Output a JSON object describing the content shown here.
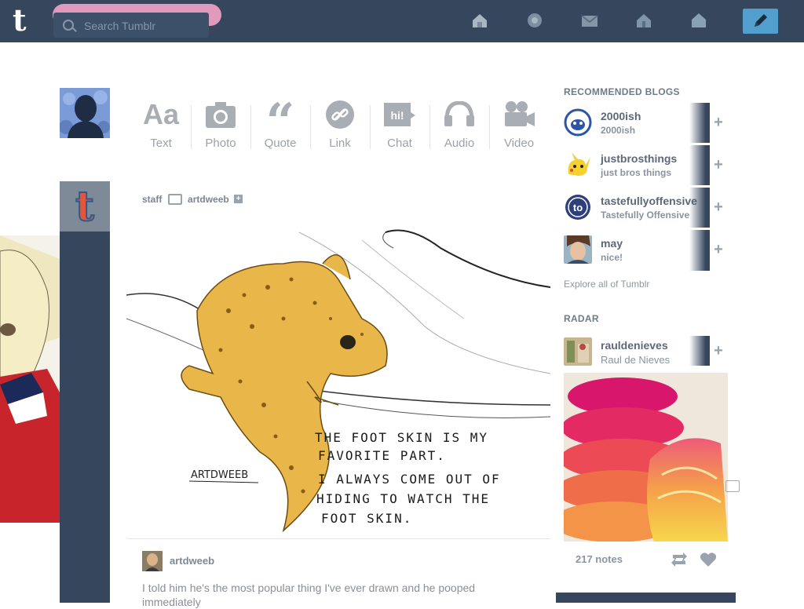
{
  "header": {
    "search_placeholder": "Search Tumblr",
    "nav_icons": [
      "home-icon",
      "explore-icon",
      "inbox-icon",
      "activity-icon",
      "account-icon"
    ],
    "compose_icon": "pencil-icon",
    "colors": {
      "bar": "#36465d",
      "compose": "#529ecc"
    }
  },
  "post_types": [
    {
      "label": "Text",
      "icon": "text-icon"
    },
    {
      "label": "Photo",
      "icon": "camera-icon"
    },
    {
      "label": "Quote",
      "icon": "quote-icon"
    },
    {
      "label": "Link",
      "icon": "link-icon"
    },
    {
      "label": "Chat",
      "icon": "chat-icon"
    },
    {
      "label": "Audio",
      "icon": "headphones-icon"
    },
    {
      "label": "Video",
      "icon": "video-camera-icon"
    }
  ],
  "post": {
    "reblogger": "staff",
    "source": "artdweeb",
    "artwork_text": {
      "signature": "ARTDWEEB",
      "line1": "THE FOOT SKIN IS MY",
      "line2": "FAVORITE PART.",
      "line3": "I ALWAYS COME OUT OF",
      "line4": "HIDING TO WATCH THE",
      "line5": "FOOT SKIN."
    },
    "author": "artdweeb",
    "caption": "I told him he's the most popular thing I've ever drawn and he pooped immediately"
  },
  "recommended": {
    "title": "RECOMMENDED BLOGS",
    "blogs": [
      {
        "name": "2000ish",
        "tagline": "2000ish"
      },
      {
        "name": "justbrosthings",
        "tagline": "just bros things"
      },
      {
        "name": "tastefullyoffensive",
        "tagline": "Tastefully Offensive"
      },
      {
        "name": "may",
        "tagline": "nice!"
      }
    ],
    "explore_label": "Explore all of Tumblr"
  },
  "radar": {
    "title": "RADAR",
    "blog": {
      "name": "rauldenieves",
      "tagline": "Raul de Nieves"
    },
    "notes": "217 notes"
  }
}
